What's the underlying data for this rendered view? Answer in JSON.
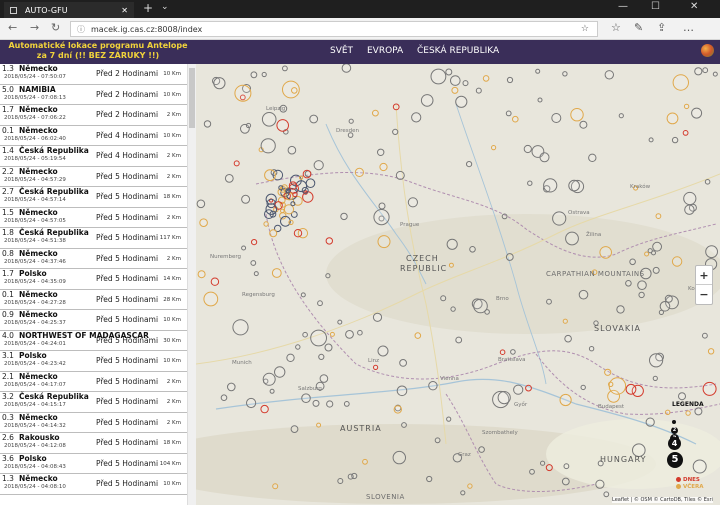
{
  "browser": {
    "tab_title": "AUTO-GFU",
    "tab_close": "✕",
    "new_tab": "+",
    "tab_menu": "⌄",
    "url": "macek.ig.cas.cz:8008/index",
    "win_minimize": "—",
    "win_restore": "☐",
    "win_close": "✕"
  },
  "header": {
    "title_line1": "Automatické lokace programu Antelope",
    "title_line2": "za 7 dní (!! BEZ ZÁRUKY !!)",
    "nav": [
      "SVĚT",
      "EVROPA",
      "ČESKÁ REPUBLIKA"
    ]
  },
  "events": [
    {
      "mag": "1.3",
      "loc": "Německo",
      "time": "2018/05/24 - 07:50:07",
      "ago": "Před 2 Hodinami",
      "depth": "10 Km"
    },
    {
      "mag": "5.0",
      "loc": "NAMIBIA",
      "time": "2018/05/24 - 07:08:13",
      "ago": "Před 2 Hodinami",
      "depth": "10 Km"
    },
    {
      "mag": "1.7",
      "loc": "Německo",
      "time": "2018/05/24 - 07:06:22",
      "ago": "Před 2 Hodinami",
      "depth": "2 Km"
    },
    {
      "mag": "0.1",
      "loc": "Německo",
      "time": "2018/05/24 - 06:02:40",
      "ago": "Před 4 Hodinami",
      "depth": "10 Km"
    },
    {
      "mag": "1.4",
      "loc": "Česká Republika",
      "time": "2018/05/24 - 05:19:54",
      "ago": "Před 4 Hodinami",
      "depth": "2 Km"
    },
    {
      "mag": "2.2",
      "loc": "Německo",
      "time": "2018/05/24 - 04:57:29",
      "ago": "Před 5 Hodinami",
      "depth": "2 Km"
    },
    {
      "mag": "2.7",
      "loc": "Česká Republika",
      "time": "2018/05/24 - 04:57:14",
      "ago": "Před 5 Hodinami",
      "depth": "18 Km"
    },
    {
      "mag": "1.5",
      "loc": "Německo",
      "time": "2018/05/24 - 04:57:05",
      "ago": "Před 5 Hodinami",
      "depth": "2 Km"
    },
    {
      "mag": "1.8",
      "loc": "Česká Republika",
      "time": "2018/05/24 - 04:51:38",
      "ago": "Před 5 Hodinami",
      "depth": "117 Km"
    },
    {
      "mag": "0.8",
      "loc": "Německo",
      "time": "2018/05/24 - 04:37:46",
      "ago": "Před 5 Hodinami",
      "depth": "2 Km"
    },
    {
      "mag": "1.7",
      "loc": "Polsko",
      "time": "2018/05/24 - 04:35:09",
      "ago": "Před 5 Hodinami",
      "depth": "14 Km"
    },
    {
      "mag": "0.1",
      "loc": "Německo",
      "time": "2018/05/24 - 04:27:28",
      "ago": "Před 5 Hodinami",
      "depth": "28 Km"
    },
    {
      "mag": "0.9",
      "loc": "Německo",
      "time": "2018/05/24 - 04:25:37",
      "ago": "Před 5 Hodinami",
      "depth": "10 Km"
    },
    {
      "mag": "4.0",
      "loc": "NORTHWEST OF MADAGASCAR",
      "time": "2018/05/24 - 04:24:01",
      "ago": "Před 5 Hodinami",
      "depth": "30 Km"
    },
    {
      "mag": "3.1",
      "loc": "Polsko",
      "time": "2018/05/24 - 04:23:42",
      "ago": "Před 5 Hodinami",
      "depth": "10 Km"
    },
    {
      "mag": "2.1",
      "loc": "Německo",
      "time": "2018/05/24 - 04:17:07",
      "ago": "Před 5 Hodinami",
      "depth": "2 Km"
    },
    {
      "mag": "3.2",
      "loc": "Česká Republika",
      "time": "2018/05/24 - 04:15:17",
      "ago": "Před 5 Hodinami",
      "depth": "2 Km"
    },
    {
      "mag": "0.3",
      "loc": "Německo",
      "time": "2018/05/24 - 04:14:32",
      "ago": "Před 5 Hodinami",
      "depth": "2 Km"
    },
    {
      "mag": "2.6",
      "loc": "Rakousko",
      "time": "2018/05/24 - 04:12:08",
      "ago": "Před 5 Hodinami",
      "depth": "18 Km"
    },
    {
      "mag": "3.6",
      "loc": "Polsko",
      "time": "2018/05/24 - 04:08:43",
      "ago": "Před 5 Hodinami",
      "depth": "104 Km"
    },
    {
      "mag": "1.3",
      "loc": "Německo",
      "time": "2018/05/24 - 04:08:10",
      "ago": "Před 5 Hodinami",
      "depth": "10 Km"
    }
  ],
  "map": {
    "labels": {
      "czech": "CZECH",
      "republic": "REPUBLIC",
      "slovakia": "SLOVAKIA",
      "austria": "AUSTRIA",
      "hungary": "HUNGARY",
      "slovenia": "SLOVENIA",
      "carpathian": "CARPATHIAN MOUNTAINS",
      "prague": "Prague",
      "vienna": "Vienna",
      "bratislava": "Bratislava",
      "budapest": "Budapest",
      "munich": "Munich",
      "brno": "Brno",
      "krakow": "Kraków",
      "ostrava": "Ostrava",
      "linz": "Linz",
      "graz": "Graz",
      "regensburg": "Regensburg",
      "nuremberg": "Nuremberg",
      "dresden": "Dresden",
      "leipzig": "Leipzig",
      "salzburg": "Salzburg",
      "zilina": "Žilina",
      "kosice": "Košice",
      "gyor": "Győr",
      "szombathely": "Szombathely"
    },
    "zoom_in": "+",
    "zoom_out": "−",
    "legend_title": "LEGENDA",
    "legend_sizes": [
      "1",
      "2",
      "3",
      "4",
      "5"
    ],
    "legend_today": "DNES",
    "legend_yesterday": "VČERA",
    "attribution": "Leaflet | © OSM © CartoDB, Tiles © Esri",
    "colors": {
      "today": "#d33a2c",
      "yesterday": "#e0a84a",
      "older": "#777777"
    }
  }
}
